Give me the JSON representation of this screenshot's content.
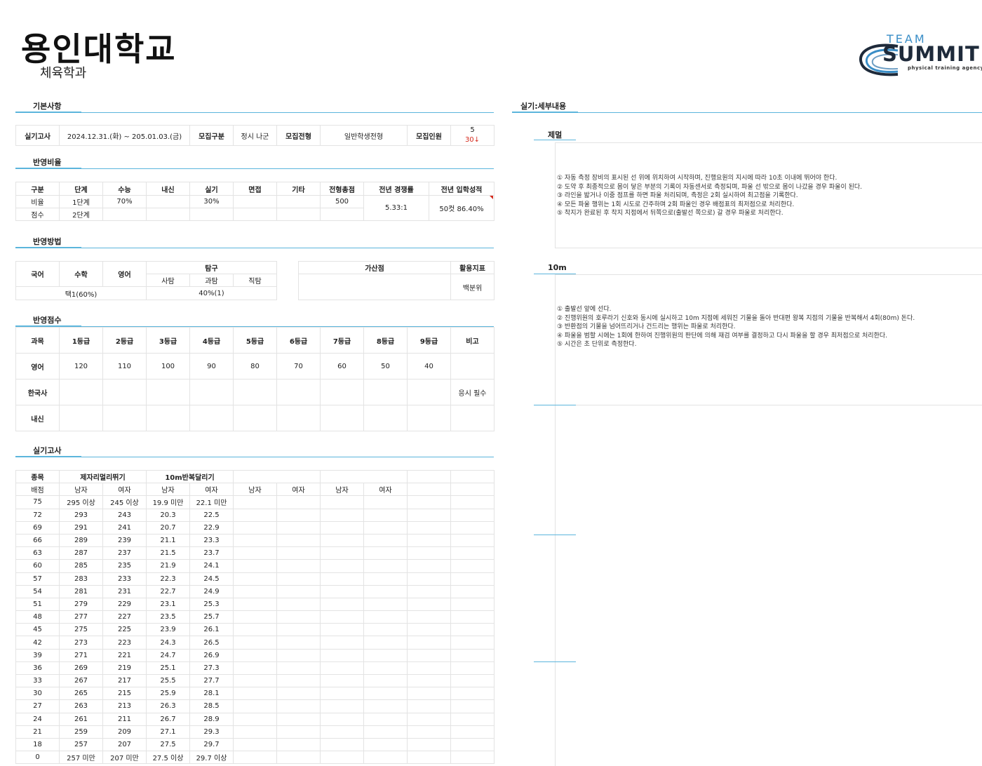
{
  "header": {
    "title": "용인대학교",
    "department": "체육학과"
  },
  "logo": {
    "team": "TEAM",
    "name": "SUMMIT",
    "tagline": "physical training agency"
  },
  "sections": {
    "basic": "기본사항",
    "ratio": "반영비율",
    "method": "반영방법",
    "score": "반영점수",
    "practical": "실기고사",
    "detail": "실기:세부내용"
  },
  "basic": {
    "label_exam": "실기고사",
    "exam_date": "2024.12.31.(화) ~ 205.01.03.(금)",
    "label_group": "모집구분",
    "group": "정시 나군",
    "label_type": "모집전형",
    "type": "일반학생전형",
    "label_quota": "모집인원",
    "quota_before": "5",
    "quota_after": "30↓"
  },
  "ratio": {
    "headers": [
      "구분",
      "단계",
      "수능",
      "내신",
      "실기",
      "면접",
      "기타",
      "전형총점",
      "전년 경쟁률",
      "전년 입학성적"
    ],
    "row1": [
      "비율",
      "1단계",
      "70%",
      "",
      "30%",
      "",
      "",
      "500"
    ],
    "row2": [
      "점수",
      "2단계",
      "",
      "",
      "",
      "",
      "",
      ""
    ],
    "competition": "5.33:1",
    "admission": "50컷 86.40%"
  },
  "method": {
    "korean": "국어",
    "math": "수학",
    "english": "영어",
    "inquiry": "탐구",
    "social": "사탐",
    "science": "과탐",
    "vocational": "직탐",
    "bonus": "가산점",
    "indicator": "활용지표",
    "indicator_value": "백분위",
    "selection": "택1(60%)",
    "inquiry_value": "40%(1)"
  },
  "score": {
    "headers": [
      "과목",
      "1등급",
      "2등급",
      "3등급",
      "4등급",
      "5등급",
      "6등급",
      "7등급",
      "8등급",
      "9등급",
      "비고"
    ],
    "rows": [
      [
        "영어",
        "120",
        "110",
        "100",
        "90",
        "80",
        "70",
        "60",
        "50",
        "40",
        ""
      ],
      [
        "한국사",
        "",
        "",
        "",
        "",
        "",
        "",
        "",
        "",
        "",
        "응시 필수"
      ],
      [
        "내신",
        "",
        "",
        "",
        "",
        "",
        "",
        "",
        "",
        "",
        ""
      ]
    ]
  },
  "practical": {
    "label_event": "종목",
    "event1": "제자리멀리뛰기",
    "event2": "10m반복달리기",
    "label_points": "배점",
    "male": "남자",
    "female": "여자",
    "rows": [
      [
        "75",
        "295 이상",
        "245 이상",
        "19.9 미만",
        "22.1 미만"
      ],
      [
        "72",
        "293",
        "243",
        "20.3",
        "22.5"
      ],
      [
        "69",
        "291",
        "241",
        "20.7",
        "22.9"
      ],
      [
        "66",
        "289",
        "239",
        "21.1",
        "23.3"
      ],
      [
        "63",
        "287",
        "237",
        "21.5",
        "23.7"
      ],
      [
        "60",
        "285",
        "235",
        "21.9",
        "24.1"
      ],
      [
        "57",
        "283",
        "233",
        "22.3",
        "24.5"
      ],
      [
        "54",
        "281",
        "231",
        "22.7",
        "24.9"
      ],
      [
        "51",
        "279",
        "229",
        "23.1",
        "25.3"
      ],
      [
        "48",
        "277",
        "227",
        "23.5",
        "25.7"
      ],
      [
        "45",
        "275",
        "225",
        "23.9",
        "26.1"
      ],
      [
        "42",
        "273",
        "223",
        "24.3",
        "26.5"
      ],
      [
        "39",
        "271",
        "221",
        "24.7",
        "26.9"
      ],
      [
        "36",
        "269",
        "219",
        "25.1",
        "27.3"
      ],
      [
        "33",
        "267",
        "217",
        "25.5",
        "27.7"
      ],
      [
        "30",
        "265",
        "215",
        "25.9",
        "28.1"
      ],
      [
        "27",
        "263",
        "213",
        "26.3",
        "28.5"
      ],
      [
        "24",
        "261",
        "211",
        "26.7",
        "28.9"
      ],
      [
        "21",
        "259",
        "209",
        "27.1",
        "29.3"
      ],
      [
        "18",
        "257",
        "207",
        "27.5",
        "29.7"
      ],
      [
        "0",
        "257 미만",
        "207 미만",
        "27.5 이상",
        "29.7 이상"
      ]
    ]
  },
  "detail": {
    "jump_title": "제멀",
    "jump_lines": [
      "① 자동 측정 장비의 표시된 선 위에 위치하여 시작하며, 진행요원의 지시에 따라 10초 이내에 뛰어야 한다.",
      "② 도약 후 최종적으로 몸이 닿은 부분의 기록이 자동센서로 측정되며, 파울 선 밖으로 몸이 나갔을 경우 파울이 된다.",
      "③ 라인을 밟거나 이중 점프를 하면 파울 처리되며, 측정은 2회 실시하여 최고점을 기록한다.",
      "④ 모든 파울 행위는 1회 시도로 간주하며 2회 파울인 경우 배점표의 최저점으로 처리한다.",
      "⑤ 착지가 완료된 후 착지 지점에서 뒤쪽으로(출발선 쪽으로) 갈 경우 파울로 처리한다."
    ],
    "run_title": "10m",
    "run_lines": [
      "① 출발선 앞에 선다.",
      "② 진행위원의 호루라기 신호와 동시에 실시하고 10m 지점에 세워진 기물을 돌아 반대편 왕복 지점의 기물을 반복해서 4회(80m) 돈다.",
      "③ 반환점의 기물을 넘어뜨리거나 건드리는 행위는 파울로 처리한다.",
      "④ 파울을 범할 시에는 1회에 한하여 진행위원의 판단에 의해 재검 여부를 결정하고 다시 파울을 할 경우 최저점으로 처리한다.",
      "⑤ 시간은 초 단위로 측정한다."
    ]
  }
}
